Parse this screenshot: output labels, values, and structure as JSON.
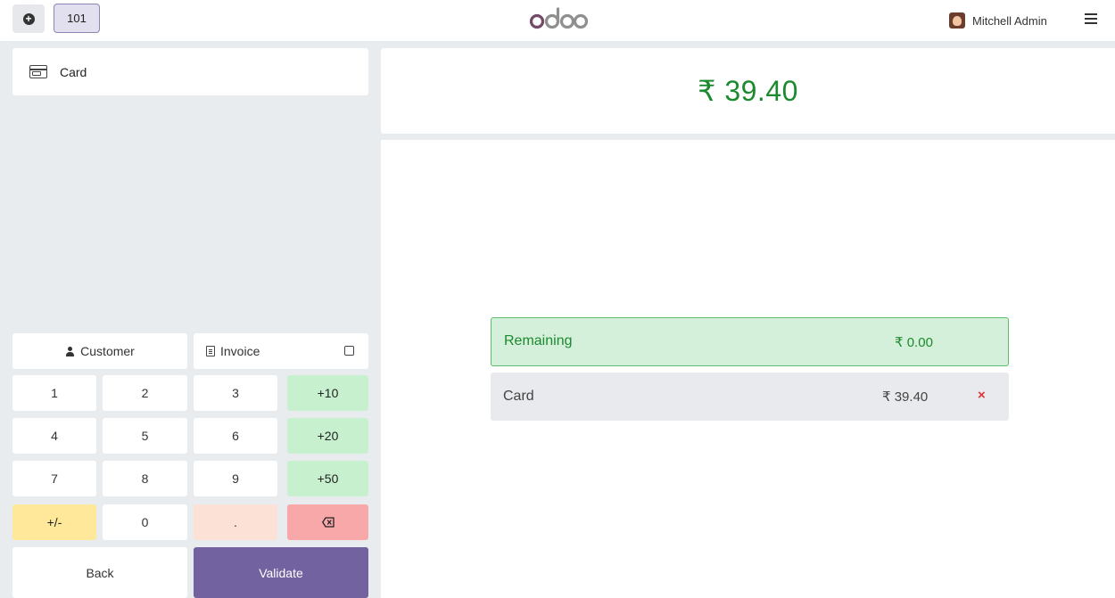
{
  "header": {
    "new_order_icon": "plus-circle-icon",
    "table_label": "101",
    "logo_text": "odoo",
    "user_name": "Mitchell Admin",
    "menu_icon": "hamburger-menu-icon"
  },
  "payment_methods": [
    {
      "label": "Card",
      "icon": "credit-card-icon"
    }
  ],
  "options": {
    "customer_label": "Customer",
    "invoice_label": "Invoice",
    "invoice_checked": false
  },
  "numpad": {
    "k1": "1",
    "k2": "2",
    "k3": "3",
    "k_plus10": "+10",
    "k4": "4",
    "k5": "5",
    "k6": "6",
    "k_plus20": "+20",
    "k7": "7",
    "k8": "8",
    "k9": "9",
    "k_plus50": "+50",
    "k_sign": "+/-",
    "k0": "0",
    "k_dot": ".",
    "k_backspace_icon": "backspace-icon"
  },
  "actions": {
    "back_label": "Back",
    "validate_label": "Validate"
  },
  "summary": {
    "total": "₹ 39.40",
    "remaining_label": "Remaining",
    "remaining_value": "₹ 0.00",
    "payment_lines": [
      {
        "method": "Card",
        "amount": "₹ 39.40",
        "delete_symbol": "×"
      }
    ]
  },
  "colors": {
    "accent": "#7263a0",
    "success": "#1c8a2f",
    "quick_amount_bg": "#c7f0cf",
    "sign_bg": "#ffe89a",
    "backspace_bg": "#f8a8a8"
  }
}
